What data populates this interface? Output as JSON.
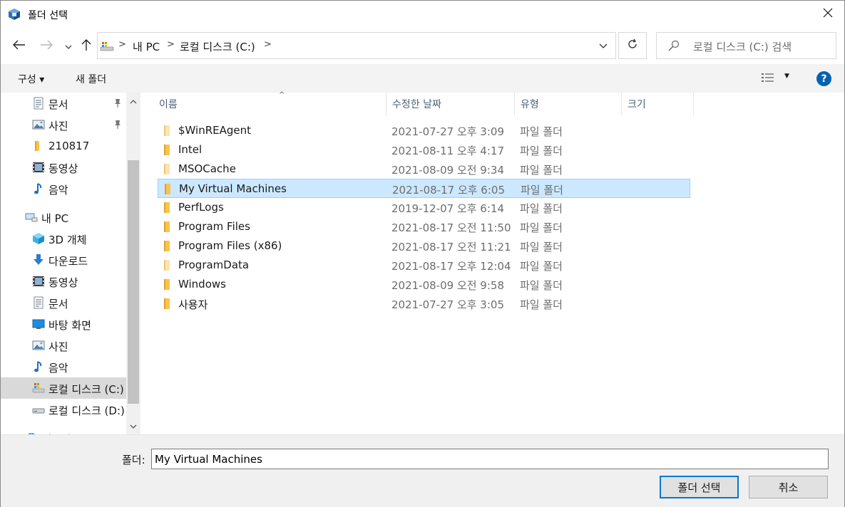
{
  "window": {
    "title": "폴더 선택"
  },
  "address": {
    "crumbs": [
      "내 PC",
      "로컬 디스크 (C:)"
    ],
    "search_placeholder": "로컬 디스크 (C:) 검색"
  },
  "toolbar": {
    "organize_label": "구성 ▾",
    "new_folder_label": "새 폴더",
    "help_label": "?"
  },
  "sidebar": {
    "items": [
      {
        "label": "문서",
        "icon": "document-icon",
        "pinned": true
      },
      {
        "label": "사진",
        "icon": "pictures-icon",
        "pinned": true
      },
      {
        "label": "210817",
        "icon": "folder-icon",
        "pinned": false
      },
      {
        "label": "동영상",
        "icon": "video-icon",
        "pinned": false
      },
      {
        "label": "음악",
        "icon": "music-icon",
        "pinned": false
      },
      {
        "label": "내 PC",
        "icon": "computer-icon",
        "pinned": false
      },
      {
        "label": "3D 개체",
        "icon": "3d-objects-icon",
        "pinned": false
      },
      {
        "label": "다운로드",
        "icon": "download-icon",
        "pinned": false
      },
      {
        "label": "동영상",
        "icon": "video-icon",
        "pinned": false
      },
      {
        "label": "문서",
        "icon": "document-icon",
        "pinned": false
      },
      {
        "label": "바탕 화면",
        "icon": "desktop-icon",
        "pinned": false
      },
      {
        "label": "사진",
        "icon": "pictures-icon",
        "pinned": false
      },
      {
        "label": "음악",
        "icon": "music-icon",
        "pinned": false
      },
      {
        "label": "로컬 디스크 (C:)",
        "icon": "system-drive-icon",
        "pinned": false,
        "selected": true
      },
      {
        "label": "로컬 디스크 (D:)",
        "icon": "drive-icon",
        "pinned": false
      },
      {
        "label": "네트워크",
        "icon": "network-icon",
        "pinned": false
      }
    ]
  },
  "columns": {
    "name": "이름",
    "date": "수정한 날짜",
    "type": "유형",
    "size": "크기"
  },
  "files": [
    {
      "name": "$WinREAgent",
      "date": "2021-07-27 오후 3:09",
      "type": "파일 폴더",
      "hidden": true
    },
    {
      "name": "Intel",
      "date": "2021-08-11 오후 4:17",
      "type": "파일 폴더",
      "hidden": false
    },
    {
      "name": "MSOCache",
      "date": "2021-08-09 오전 9:34",
      "type": "파일 폴더",
      "hidden": true
    },
    {
      "name": "My Virtual Machines",
      "date": "2021-08-17 오후 6:05",
      "type": "파일 폴더",
      "hidden": false,
      "selected": true
    },
    {
      "name": "PerfLogs",
      "date": "2019-12-07 오후 6:14",
      "type": "파일 폴더",
      "hidden": false
    },
    {
      "name": "Program Files",
      "date": "2021-08-17 오전 11:50",
      "type": "파일 폴더",
      "hidden": false
    },
    {
      "name": "Program Files (x86)",
      "date": "2021-08-17 오전 11:21",
      "type": "파일 폴더",
      "hidden": false
    },
    {
      "name": "ProgramData",
      "date": "2021-08-17 오후 12:04",
      "type": "파일 폴더",
      "hidden": true
    },
    {
      "name": "Windows",
      "date": "2021-08-09 오전 9:58",
      "type": "파일 폴더",
      "hidden": false
    },
    {
      "name": "사용자",
      "date": "2021-07-27 오후 3:05",
      "type": "파일 폴더",
      "hidden": false
    }
  ],
  "footer": {
    "folder_label": "폴더:",
    "folder_value": "My Virtual Machines",
    "select_button": "폴더 선택",
    "cancel_button": "취소"
  },
  "colors": {
    "accent": "#0078d7",
    "selection_fill": "#cce8ff",
    "selection_border": "#99d1ff",
    "folder_yellow": "#f8c44c",
    "help_blue": "#0063b1"
  }
}
